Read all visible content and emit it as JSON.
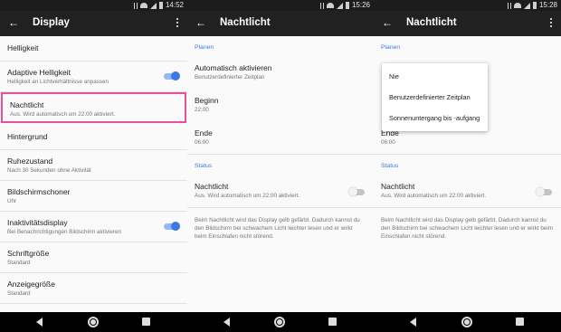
{
  "panel1": {
    "status_time": "14:52",
    "title": "Display",
    "items": [
      {
        "label": "Helligkeit",
        "sub": ""
      },
      {
        "label": "Adaptive Helligkeit",
        "sub": "Helligkeit an Lichtverhältnisse anpassen",
        "toggle": "on"
      },
      {
        "label": "Nachtlicht",
        "sub": "Aus. Wird automatisch um 22:00 aktiviert.",
        "highlighted": true
      },
      {
        "label": "Hintergrund",
        "sub": ""
      },
      {
        "label": "Ruhezustand",
        "sub": "Nach 30 Sekunden ohne Aktivität"
      },
      {
        "label": "Bildschirmschoner",
        "sub": "Uhr"
      },
      {
        "label": "Inaktivitätsdisplay",
        "sub": "Bei Benachrichtigungen Bildschirm aktivieren",
        "toggle": "on"
      },
      {
        "label": "Schriftgröße",
        "sub": "Standard"
      },
      {
        "label": "Anzeigegröße",
        "sub": "Standard"
      }
    ]
  },
  "panel2": {
    "status_time": "15:26",
    "title": "Nachtlicht",
    "section_plan": "Planen",
    "auto_label": "Automatisch aktivieren",
    "auto_value": "Benutzerdefinierter Zeitplan",
    "start_label": "Beginn",
    "start_value": "22:00",
    "end_label": "Ende",
    "end_value": "06:00",
    "section_status": "Status",
    "night_label": "Nachtlicht",
    "night_value": "Aus. Wird automatisch um 22:00 aktiviert.",
    "footer": "Beim Nachtlicht wird das Display gelb gefärbt. Dadurch kannst du den Bildschirm bei schwachem Licht leichter lesen und er wirkt beim Einschlafen nicht störend."
  },
  "panel3": {
    "status_time": "15:28",
    "title": "Nachtlicht",
    "section_plan": "Planen",
    "end_label": "Ende",
    "end_value": "06:00",
    "section_status": "Status",
    "night_label": "Nachtlicht",
    "night_value": "Aus. Wird automatisch um 22:00 aktiviert.",
    "footer": "Beim Nachtlicht wird das Display gelb gefärbt. Dadurch kannst du den Bildschirm bei schwachem Licht leichter lesen und er wirkt beim Einschlafen nicht störend.",
    "dropdown_options": [
      "Nie",
      "Benutzerdefinierter Zeitplan",
      "Sonnenuntergang bis -aufgang"
    ]
  },
  "colors": {
    "accent": "#3b78e7",
    "highlight": "#e8509a",
    "appbar": "#212121"
  },
  "icons": {
    "statusbar": [
      "bluetooth-icon",
      "wifi-icon",
      "signal-icon",
      "battery-icon"
    ],
    "appbar": [
      "back-arrow-icon",
      "more-vert-icon"
    ],
    "navbar": [
      "nav-back-icon",
      "nav-home-icon",
      "nav-recents-icon"
    ]
  }
}
